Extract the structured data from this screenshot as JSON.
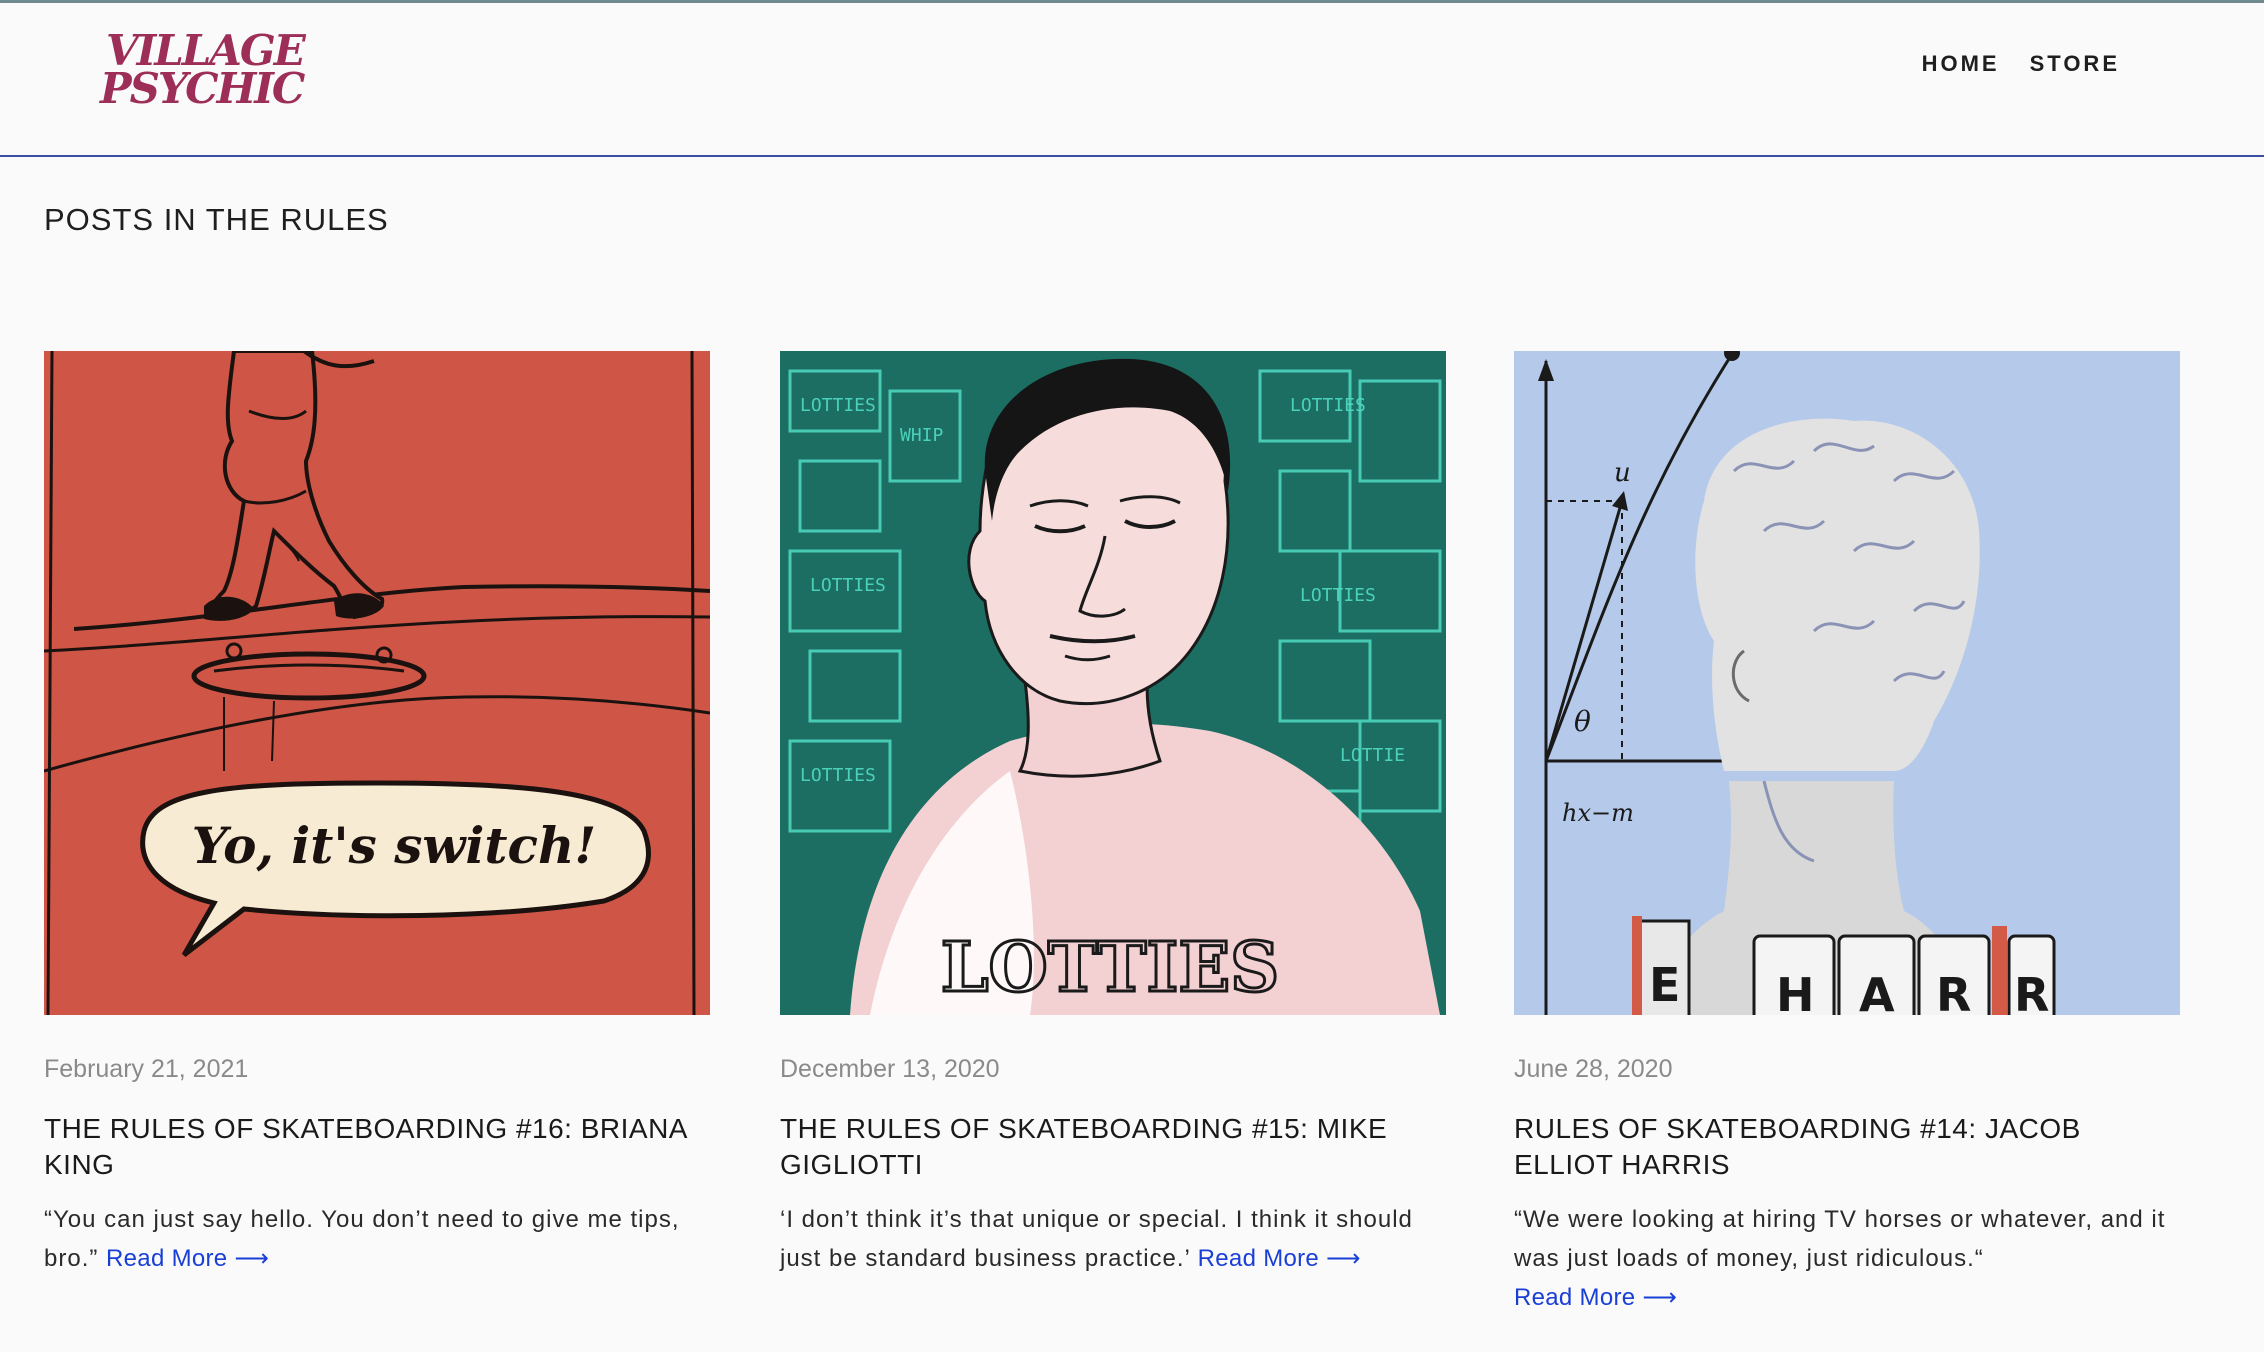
{
  "site": {
    "logo_line1": "VILLAGE",
    "logo_line2": "PSYCHIC",
    "nav": [
      "HOME",
      "STORE"
    ]
  },
  "section_title": "POSTS IN THE RULES",
  "posts": [
    {
      "date": "February 21, 2021",
      "title": "THE RULES OF SKATEBOARDING #16: BRIANA KING",
      "excerpt": "“You can just say hello. You don’t need to give me tips, bro.”",
      "read_more": "Read More ⟶",
      "image_text": "Yo, it's switch!"
    },
    {
      "date": "December 13, 2020",
      "title": "THE RULES OF SKATEBOARDING #15: MIKE GIGLIOTTI",
      "excerpt": "‘I don’t think it’s that unique or special. I think it should just be standard business practice.’",
      "read_more": "Read More ⟶",
      "image_text": "LOTTIES"
    },
    {
      "date": "June 28, 2020",
      "title": "RULES OF SKATEBOARDING #14: JACOB ELLIOT HARRIS",
      "excerpt": "“We were looking at hiring TV horses or whatever, and it was just loads of money, just ridiculous.“",
      "read_more": "Read More ⟶",
      "image_letters": [
        "E",
        "H",
        "A",
        "R",
        "R"
      ]
    }
  ],
  "colors": {
    "brand": "#9c2e57",
    "link": "#1a3fd6",
    "header_border": "#3a4fa4"
  }
}
